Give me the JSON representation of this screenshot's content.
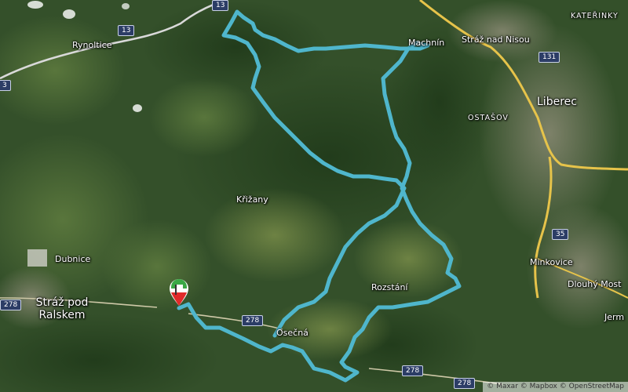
{
  "places": {
    "rynoltice": "Rynoltice",
    "machnin": "Machnín",
    "straz_nad_nisou": "Stráž nad Nisou",
    "katerinky": "KATEŘINKY",
    "liberec": "Liberec",
    "ostasov": "OSTAŠOV",
    "krizany": "Křižany",
    "dubnice": "Dubnice",
    "straz_pod_ralskem": "Stráž pod Ralskem",
    "rozstani": "Rozstání",
    "osecna": "Osečná",
    "minkovice": "Minkovice",
    "dlouhy_most": "Dlouhý Most",
    "jerm": "Jerm"
  },
  "roads": {
    "r13_top": "13",
    "r13": "13",
    "r3": "3",
    "r131": "131",
    "r35": "35",
    "r278_left": "278",
    "r278_mid": "278",
    "r278_bottom": "278",
    "r278_right": "278"
  },
  "attribution": "© Maxar © Mapbox © OpenStreetMap",
  "colors": {
    "route": "#4fb6cc",
    "highway": "#e6c34a",
    "start_flag_green": "#3aa845",
    "start_flag_red": "#e02a2a"
  },
  "icons": {
    "start_marker": "start-finish-flag-icon"
  }
}
